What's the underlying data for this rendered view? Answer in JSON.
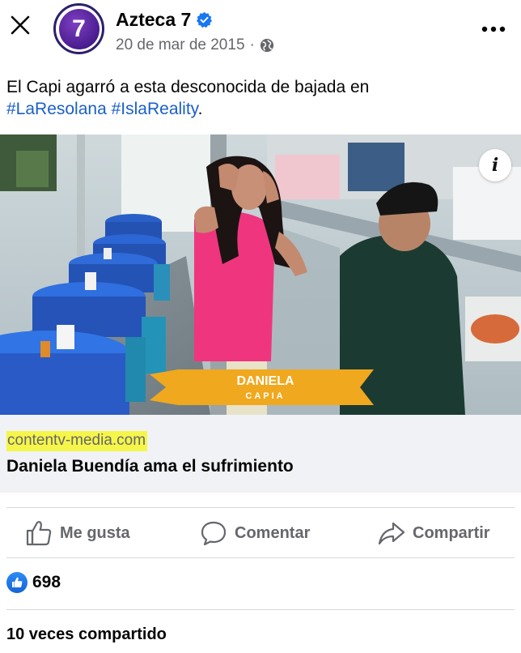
{
  "header": {
    "close_icon": "close-icon",
    "page_name": "Azteca 7",
    "verified_icon": "verified-badge-icon",
    "date": "20 de mar de 2015",
    "separator": "·",
    "audience_icon": "globe-icon",
    "more_icon": "more-options-icon",
    "avatar_letter": "7"
  },
  "post": {
    "text": "El Capi agarró a esta desconocida de bajada en",
    "hashtags": [
      "#LaResolana",
      "#IslaReality"
    ],
    "text_end": "."
  },
  "media": {
    "banner_name": "DANIELA",
    "banner_sub": "CAPIA",
    "info_label": "i"
  },
  "link_preview": {
    "domain": "contentv-media.com",
    "title": "Daniela Buendía ama el sufrimiento"
  },
  "actions": {
    "like_label": "Me gusta",
    "comment_label": "Comentar",
    "share_label": "Compartir"
  },
  "reactions": {
    "count": "698"
  },
  "shares": {
    "text": "10 veces compartido"
  },
  "colors": {
    "hashtag": "#1b5fc7",
    "meta_gray": "#65676b",
    "verified_blue": "#1877f2",
    "highlight": "#f6f64a",
    "banner_gold": "#f0a81e"
  }
}
